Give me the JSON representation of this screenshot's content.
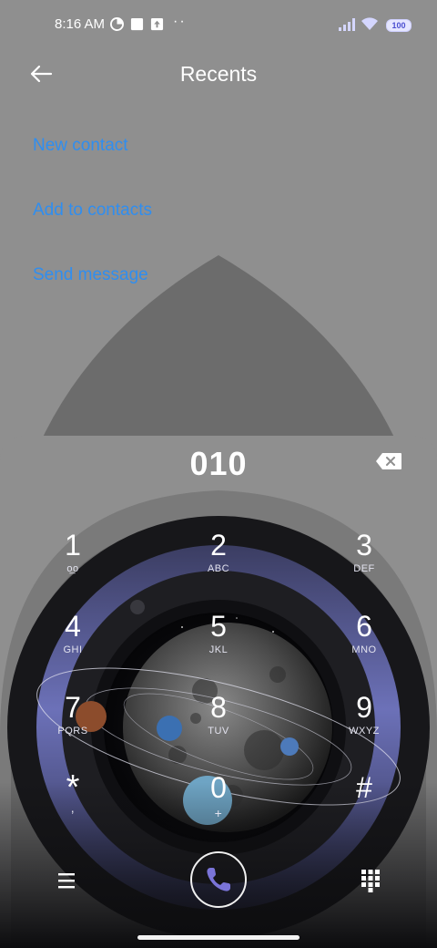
{
  "status_bar": {
    "time": "8:16 AM",
    "battery": "100"
  },
  "header": {
    "title": "Recents"
  },
  "actions": [
    "New contact",
    "Add to contacts",
    "Send message"
  ],
  "dial": {
    "number": "010"
  },
  "keys": [
    {
      "digit": "1",
      "letters": "ᴏ̲ᴏ"
    },
    {
      "digit": "2",
      "letters": "ABC"
    },
    {
      "digit": "3",
      "letters": "DEF"
    },
    {
      "digit": "4",
      "letters": "GHI"
    },
    {
      "digit": "5",
      "letters": "JKL"
    },
    {
      "digit": "6",
      "letters": "MNO"
    },
    {
      "digit": "7",
      "letters": "PQRS"
    },
    {
      "digit": "8",
      "letters": "TUV"
    },
    {
      "digit": "9",
      "letters": "WXYZ"
    },
    {
      "digit": "*",
      "letters": ","
    },
    {
      "digit": "0",
      "letters": "+"
    },
    {
      "digit": "#",
      "letters": ""
    }
  ],
  "colors": {
    "accent_link": "#2f8ef0",
    "panel_gray": "#8f8f8f",
    "ring_purple": "#5a5f9e"
  }
}
